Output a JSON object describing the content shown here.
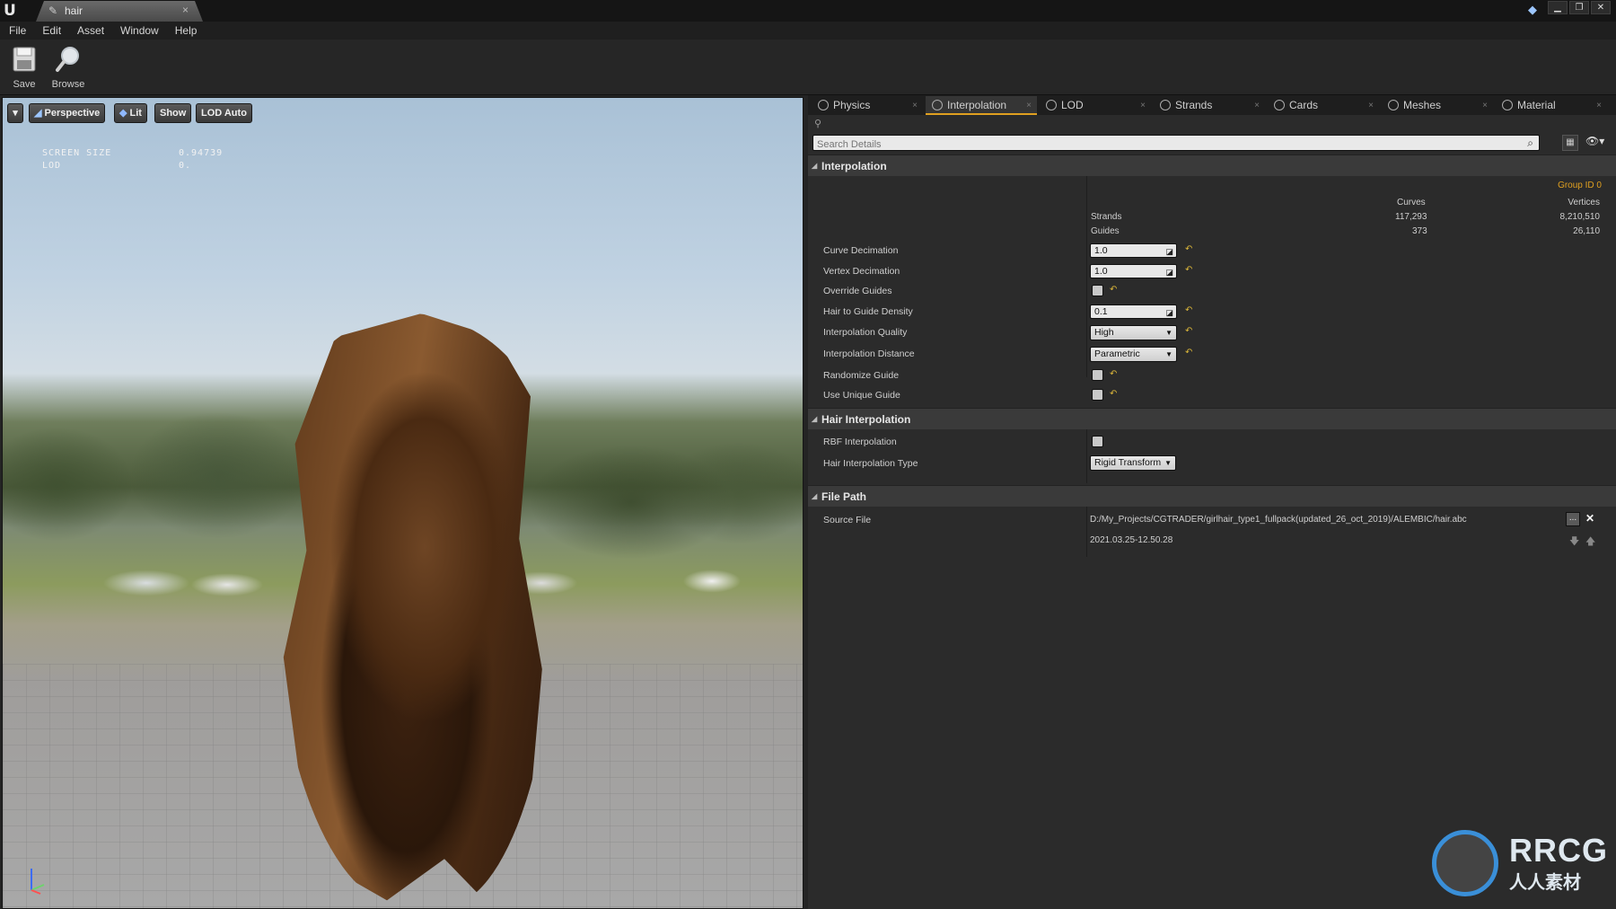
{
  "titlebar": {
    "tab_title": "hair",
    "logo": "U"
  },
  "menu": [
    "File",
    "Edit",
    "Asset",
    "Window",
    "Help"
  ],
  "toolbar": {
    "save_label": "Save",
    "browse_label": "Browse"
  },
  "viewport": {
    "perspective_label": "Perspective",
    "lit_label": "Lit",
    "show_label": "Show",
    "lod_label": "LOD Auto",
    "stats": [
      {
        "name": "SCREEN SIZE",
        "value": "0.94739"
      },
      {
        "name": "LOD",
        "value": "0."
      }
    ]
  },
  "tabs": [
    "Physics",
    "Interpolation",
    "LOD",
    "Strands",
    "Cards",
    "Meshes",
    "Material"
  ],
  "active_tab": "Interpolation",
  "search": {
    "placeholder": "Search Details"
  },
  "interpolation": {
    "header": "Interpolation",
    "group_id": "Group ID 0",
    "stats_headers": {
      "curves": "Curves",
      "vertices": "Vertices"
    },
    "stats_rows": [
      {
        "name": "Strands",
        "curves": "117,293",
        "vertices": "8,210,510"
      },
      {
        "name": "Guides",
        "curves": "373",
        "vertices": "26,110"
      }
    ],
    "curve_decimation_label": "Curve Decimation",
    "curve_decimation_value": "1.0",
    "vertex_decimation_label": "Vertex Decimation",
    "vertex_decimation_value": "1.0",
    "override_guides_label": "Override Guides",
    "hair_to_guide_density_label": "Hair to Guide Density",
    "hair_to_guide_density_value": "0.1",
    "interpolation_quality_label": "Interpolation Quality",
    "interpolation_quality_value": "High",
    "interpolation_distance_label": "Interpolation Distance",
    "interpolation_distance_value": "Parametric",
    "randomize_guide_label": "Randomize Guide",
    "use_unique_guide_label": "Use Unique Guide"
  },
  "hair_interpolation": {
    "header": "Hair Interpolation",
    "rbf_label": "RBF Interpolation",
    "type_label": "Hair Interpolation Type",
    "type_value": "Rigid Transform"
  },
  "file_path": {
    "header": "File Path",
    "source_label": "Source File",
    "source_value": "D:/My_Projects/CGTRADER/girlhair_type1_fullpack(updated_26_oct_2019)/ALEMBIC/hair.abc",
    "timestamp": "2021.03.25-12.50.28",
    "browse_btn": "..."
  },
  "watermark": {
    "brand": "RRCG",
    "sub": "人人素材"
  },
  "colors": {
    "accent": "#e0a020",
    "reset": "#d9b53a",
    "watermark": "#3a8fd8"
  }
}
